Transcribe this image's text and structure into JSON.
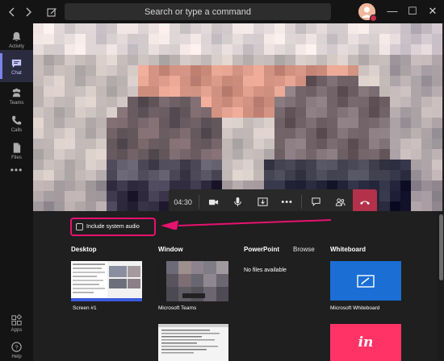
{
  "titlebar": {
    "search_placeholder": "Search or type a command",
    "back_icon": "chevron-left-icon",
    "forward_icon": "chevron-right-icon",
    "compose_icon": "compose-icon",
    "minimize_glyph": "—",
    "maximize_glyph": "☐",
    "close_glyph": "✕"
  },
  "rail": {
    "items": [
      {
        "label": "Activity",
        "icon": "bell-icon"
      },
      {
        "label": "Chat",
        "icon": "chat-icon",
        "active": true
      },
      {
        "label": "Teams",
        "icon": "teams-icon"
      },
      {
        "label": "Calls",
        "icon": "phone-icon"
      },
      {
        "label": "Files",
        "icon": "file-icon"
      }
    ],
    "bottom": [
      {
        "label": "Apps",
        "icon": "apps-icon"
      },
      {
        "label": "Help",
        "icon": "help-icon"
      }
    ]
  },
  "call": {
    "timer": "04:30",
    "controls": [
      "camera-icon",
      "mic-icon",
      "share-tray-icon",
      "more-icon",
      "chat-bubble-icon",
      "participants-icon",
      "hang-up-icon"
    ]
  },
  "share": {
    "include_audio_label": "Include system audio",
    "include_audio_checked": false,
    "desktop": {
      "heading": "Desktop",
      "screen_label": "Screen #1"
    },
    "window": {
      "heading": "Window",
      "window_label": "Microsoft Teams"
    },
    "powerpoint": {
      "heading": "PowerPoint",
      "browse_label": "Browse",
      "empty_text": "No files available"
    },
    "whiteboard": {
      "heading": "Whiteboard",
      "item_label": "Microsoft Whiteboard",
      "second_item_text": "in"
    }
  },
  "colors": {
    "highlight": "#e8126f",
    "hangup": "#b3314a",
    "whiteboard_tile": "#1a6ed4",
    "invision_tile": "#ff3366",
    "rail_active": "#7b83eb"
  }
}
